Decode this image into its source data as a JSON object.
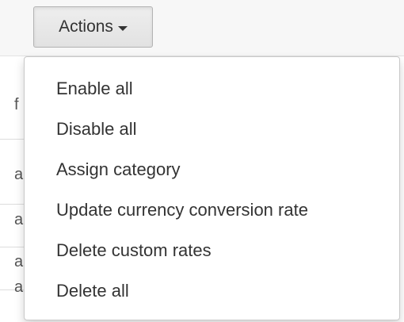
{
  "toolbar": {
    "actions_label": "Actions"
  },
  "background_rows": {
    "glyphs": [
      "f",
      "a",
      "a",
      "a",
      "a"
    ]
  },
  "dropdown": {
    "items": [
      {
        "label": "Enable all"
      },
      {
        "label": "Disable all"
      },
      {
        "label": "Assign category"
      },
      {
        "label": "Update currency conversion rate"
      },
      {
        "label": "Delete custom rates"
      },
      {
        "label": "Delete all"
      }
    ]
  },
  "icons": {
    "caret": "chevron-down-icon"
  }
}
